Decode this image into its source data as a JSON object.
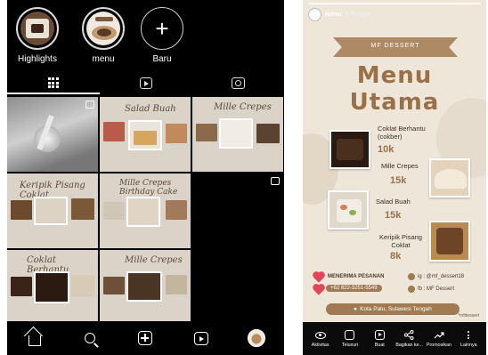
{
  "profile": {
    "highlights": [
      {
        "label": "Highlights"
      },
      {
        "label": "menu"
      },
      {
        "label": "Baru"
      }
    ],
    "tabs": [
      "grid",
      "reels",
      "tagged"
    ],
    "grid_cells": [
      {
        "type": "video",
        "title": ""
      },
      {
        "type": "post",
        "title": "Salad Buah"
      },
      {
        "type": "post",
        "title": "Mille Crepes"
      },
      {
        "type": "post",
        "title": "Keripik Pisang Coklat"
      },
      {
        "type": "post",
        "title": "Mille Crepes Birthday Cake"
      },
      {
        "type": "video",
        "title": ""
      },
      {
        "type": "post",
        "title": "Coklat Berhantu"
      },
      {
        "type": "post",
        "title": "Mille Crepes"
      }
    ],
    "bottom_nav": [
      "home",
      "search",
      "create",
      "reels",
      "profile"
    ]
  },
  "story": {
    "username": "menu",
    "time": "1 minggu",
    "ribbon": "MF DESSERT",
    "title_line1": "Menu",
    "title_line2": "Utama",
    "items": [
      {
        "name": "Coklat Berhantu (cokber)",
        "price": "10k"
      },
      {
        "name": "Mille Crepes",
        "price": "15k"
      },
      {
        "name": "Salad Buah",
        "price": "15k"
      },
      {
        "name": "Keripik Pisang Coklat",
        "price": "8k"
      }
    ],
    "order_label": "MENERIMA PESANAN",
    "phone": "+62 822-3251-5549",
    "ig": "ig : @mf_dessert18",
    "fb": "fb : MF Dessert",
    "location": "Kota Palu, Sulawesi Tengah",
    "credit": "*mfdessert",
    "actions": [
      {
        "label": "Aktivitas",
        "icon": "eye-icon"
      },
      {
        "label": "Telusuri",
        "icon": "frame-icon"
      },
      {
        "label": "Buat",
        "icon": "create-icon"
      },
      {
        "label": "Bagikan ke...",
        "icon": "share-icon"
      },
      {
        "label": "Promosikan",
        "icon": "trend-icon"
      },
      {
        "label": "Lainnya",
        "icon": "more-icon"
      }
    ]
  },
  "colors": {
    "brand_brown": "#9a7047",
    "story_bg": "#efe6da",
    "heart": "#e0455a"
  }
}
